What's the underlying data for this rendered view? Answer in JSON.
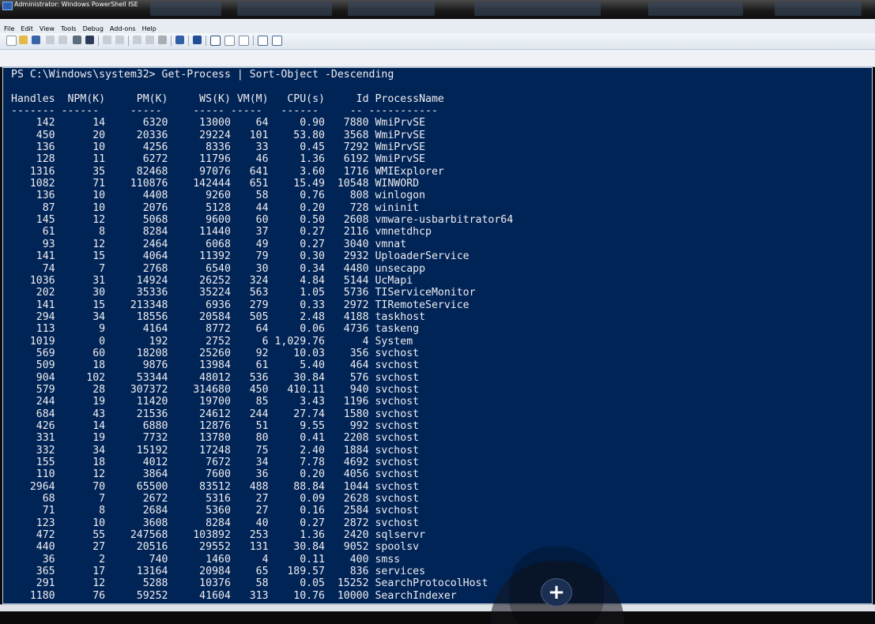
{
  "window": {
    "title": "Administrator: Windows PowerShell ISE"
  },
  "menu": [
    "File",
    "Edit",
    "View",
    "Tools",
    "Debug",
    "Add-ons",
    "Help"
  ],
  "toolbar_icons": [
    "new-file-icon",
    "open-folder-icon",
    "save-icon",
    "cut-icon",
    "copy-icon",
    "paste-icon",
    "clear-icon",
    "undo-icon",
    "redo-icon",
    "run-icon",
    "run-selection-icon",
    "stop-icon",
    "remote-icon",
    "powershell-icon",
    "layout-icon",
    "split-icon",
    "maximize-icon",
    "snippet-icon",
    "show-command-icon"
  ],
  "console": {
    "prompt": "PS C:\\Windows\\system32> Get-Process | Sort-Object -Descending",
    "headers": [
      "Handles",
      "NPM(K)",
      "PM(K)",
      "WS(K)",
      "VM(M)",
      "CPU(s)",
      "Id",
      "ProcessName"
    ],
    "separators": [
      "-------",
      "------",
      "-----",
      "----- -----",
      "------",
      "--",
      "-----------"
    ],
    "rows": [
      [
        "142",
        "14",
        "6320",
        "13000",
        "64",
        "0.90",
        "7880",
        "WmiPrvSE"
      ],
      [
        "450",
        "20",
        "20336",
        "29224",
        "101",
        "53.80",
        "3568",
        "WmiPrvSE"
      ],
      [
        "136",
        "10",
        "4256",
        "8336",
        "33",
        "0.45",
        "7292",
        "WmiPrvSE"
      ],
      [
        "128",
        "11",
        "6272",
        "11796",
        "46",
        "1.36",
        "6192",
        "WmiPrvSE"
      ],
      [
        "1316",
        "35",
        "82468",
        "97076",
        "641",
        "3.60",
        "1716",
        "WMIExplorer"
      ],
      [
        "1082",
        "71",
        "110876",
        "142444",
        "651",
        "15.49",
        "10548",
        "WINWORD"
      ],
      [
        "136",
        "10",
        "4408",
        "9260",
        "58",
        "0.76",
        "808",
        "winlogon"
      ],
      [
        "87",
        "10",
        "2076",
        "5128",
        "44",
        "0.20",
        "728",
        "wininit"
      ],
      [
        "145",
        "12",
        "5068",
        "9600",
        "60",
        "0.50",
        "2608",
        "vmware-usbarbitrator64"
      ],
      [
        "61",
        "8",
        "8284",
        "11440",
        "37",
        "0.27",
        "2116",
        "vmnetdhcp"
      ],
      [
        "93",
        "12",
        "2464",
        "6068",
        "49",
        "0.27",
        "3040",
        "vmnat"
      ],
      [
        "141",
        "15",
        "4064",
        "11392",
        "79",
        "0.30",
        "2932",
        "UploaderService"
      ],
      [
        "74",
        "7",
        "2768",
        "6540",
        "30",
        "0.34",
        "4480",
        "unsecapp"
      ],
      [
        "1036",
        "31",
        "14924",
        "26252",
        "324",
        "4.84",
        "5144",
        "UcMapi"
      ],
      [
        "202",
        "30",
        "35336",
        "35224",
        "563",
        "1.05",
        "5736",
        "TIServiceMonitor"
      ],
      [
        "141",
        "15",
        "213348",
        "6936",
        "279",
        "0.33",
        "2972",
        "TIRemoteService"
      ],
      [
        "294",
        "34",
        "18556",
        "20584",
        "505",
        "2.48",
        "4188",
        "taskhost"
      ],
      [
        "113",
        "9",
        "4164",
        "8772",
        "64",
        "0.06",
        "4736",
        "taskeng"
      ],
      [
        "1019",
        "0",
        "192",
        "2752",
        "6",
        "1,029.76",
        "4",
        "System"
      ],
      [
        "569",
        "60",
        "18208",
        "25260",
        "92",
        "10.03",
        "356",
        "svchost"
      ],
      [
        "509",
        "18",
        "9876",
        "13984",
        "61",
        "5.40",
        "464",
        "svchost"
      ],
      [
        "904",
        "102",
        "53344",
        "48012",
        "536",
        "30.84",
        "576",
        "svchost"
      ],
      [
        "579",
        "28",
        "307372",
        "314680",
        "450",
        "410.11",
        "940",
        "svchost"
      ],
      [
        "244",
        "19",
        "11420",
        "19700",
        "85",
        "3.43",
        "1196",
        "svchost"
      ],
      [
        "684",
        "43",
        "21536",
        "24612",
        "244",
        "27.74",
        "1580",
        "svchost"
      ],
      [
        "426",
        "14",
        "6880",
        "12876",
        "51",
        "9.55",
        "992",
        "svchost"
      ],
      [
        "331",
        "19",
        "7732",
        "13780",
        "80",
        "0.41",
        "2208",
        "svchost"
      ],
      [
        "332",
        "34",
        "15192",
        "17248",
        "75",
        "2.40",
        "1884",
        "svchost"
      ],
      [
        "155",
        "18",
        "4012",
        "7672",
        "34",
        "7.78",
        "4692",
        "svchost"
      ],
      [
        "110",
        "12",
        "3864",
        "7600",
        "36",
        "0.20",
        "4056",
        "svchost"
      ],
      [
        "2964",
        "70",
        "65500",
        "83512",
        "488",
        "88.84",
        "1044",
        "svchost"
      ],
      [
        "68",
        "7",
        "2672",
        "5316",
        "27",
        "0.09",
        "2628",
        "svchost"
      ],
      [
        "71",
        "8",
        "2684",
        "5360",
        "27",
        "0.16",
        "2584",
        "svchost"
      ],
      [
        "123",
        "10",
        "3608",
        "8284",
        "40",
        "0.27",
        "2872",
        "svchost"
      ],
      [
        "472",
        "55",
        "247568",
        "103892",
        "253",
        "1.36",
        "2420",
        "sqlservr"
      ],
      [
        "440",
        "27",
        "20516",
        "29552",
        "131",
        "30.84",
        "9052",
        "spoolsv"
      ],
      [
        "36",
        "2",
        "740",
        "1460",
        "4",
        "0.11",
        "400",
        "smss"
      ],
      [
        "365",
        "17",
        "13164",
        "20984",
        "65",
        "189.57",
        "836",
        "services"
      ],
      [
        "291",
        "12",
        "5288",
        "10376",
        "58",
        "0.05",
        "15252",
        "SearchProtocolHost"
      ],
      [
        "1180",
        "76",
        "59252",
        "41604",
        "313",
        "10.76",
        "10000",
        "SearchIndexer"
      ]
    ]
  },
  "overlay_button": {
    "label": "+",
    "icon": "plus-icon"
  },
  "colors": {
    "console_bg": "#012456",
    "console_fg": "#eeedf0"
  }
}
